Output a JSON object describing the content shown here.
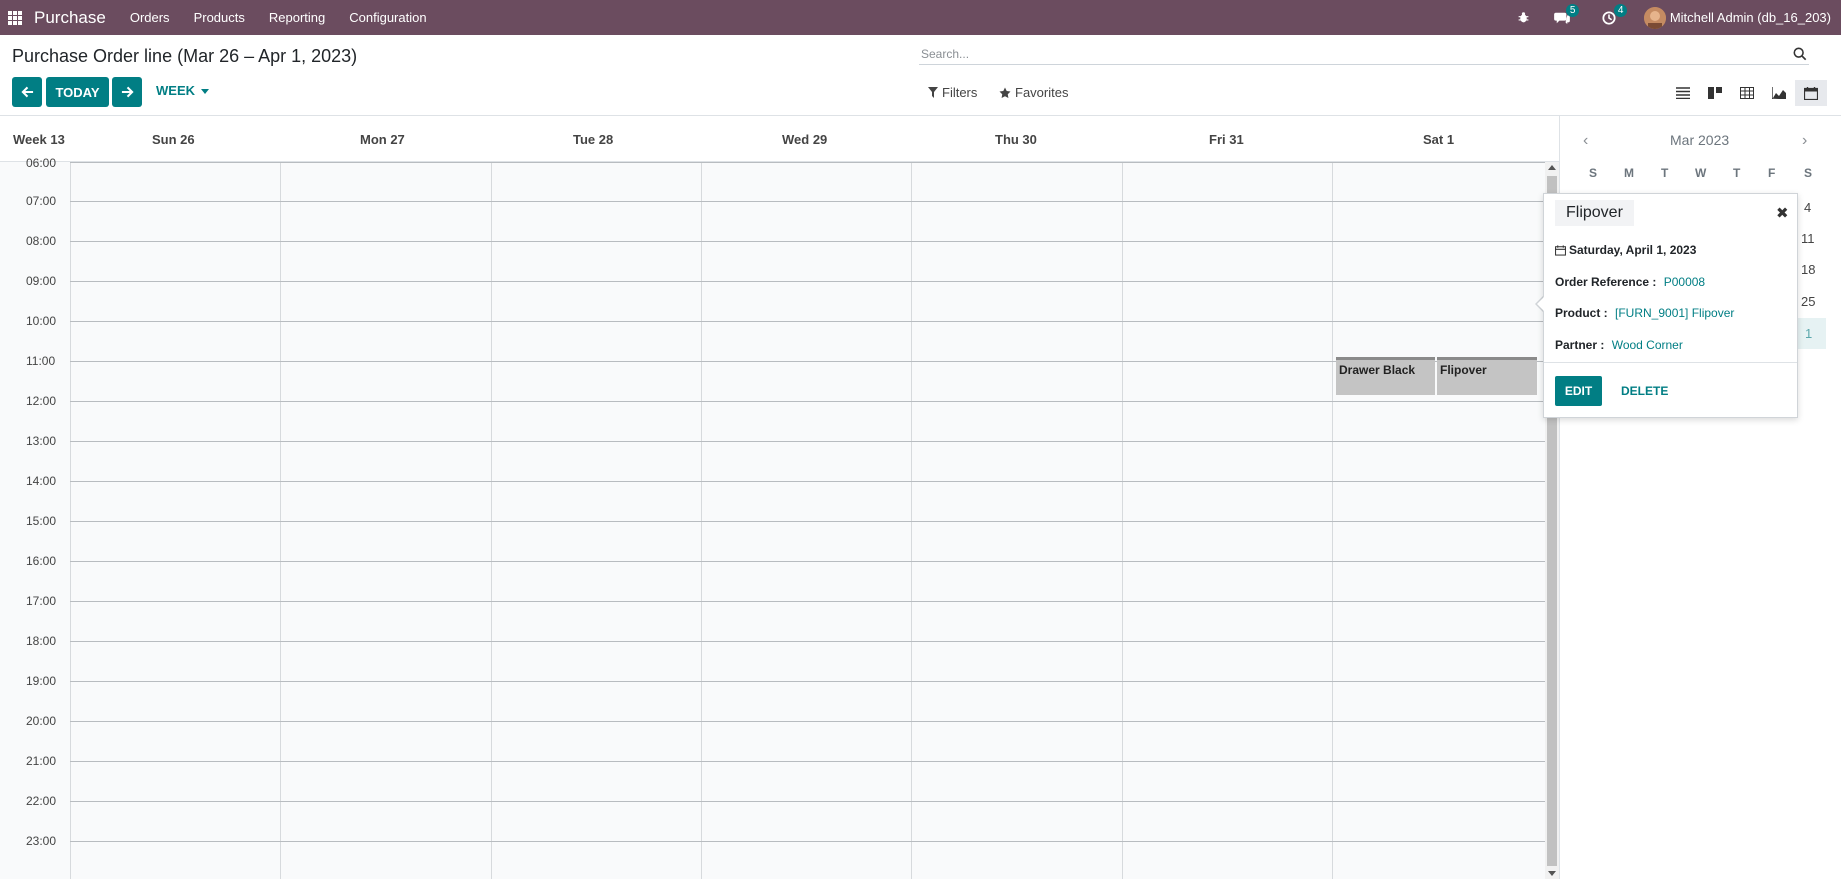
{
  "navbar": {
    "app_name": "Purchase",
    "menu": [
      "Orders",
      "Products",
      "Reporting",
      "Configuration"
    ],
    "messages_count": "5",
    "activities_count": "4",
    "user": "Mitchell Admin (db_16_203)"
  },
  "control": {
    "title": "Purchase Order line (Mar 26 – Apr 1, 2023)",
    "search_placeholder": "Search...",
    "today": "TODAY",
    "scale": "WEEK",
    "filters": "Filters",
    "favorites": "Favorites"
  },
  "calendar": {
    "week_label": "Week 13",
    "days": [
      "Sun 26",
      "Mon 27",
      "Tue 28",
      "Wed 29",
      "Thu 30",
      "Fri 31",
      "Sat 1"
    ],
    "hours": [
      "06:00",
      "07:00",
      "08:00",
      "09:00",
      "10:00",
      "11:00",
      "12:00",
      "13:00",
      "14:00",
      "15:00",
      "16:00",
      "17:00",
      "18:00",
      "19:00",
      "20:00",
      "21:00",
      "22:00",
      "23:00"
    ],
    "events": [
      {
        "title": "Drawer Black"
      },
      {
        "title": "Flipover"
      }
    ]
  },
  "mini_calendar": {
    "month": "Mar 2023",
    "weekdays": [
      "S",
      "M",
      "T",
      "W",
      "T",
      "F",
      "S"
    ],
    "visible_days": [
      "4",
      "11",
      "18",
      "25",
      "1"
    ]
  },
  "popover": {
    "title": "Flipover",
    "date": "Saturday, April 1, 2023",
    "order_ref_label": "Order Reference :",
    "order_ref": "P00008",
    "product_label": "Product :",
    "product": "[FURN_9001] Flipover",
    "partner_label": "Partner :",
    "partner": "Wood Corner",
    "edit": "EDIT",
    "delete": "DELETE"
  },
  "colors": {
    "navbar": "#6b4c5f",
    "primary": "#017e84",
    "event": "#c4c4c4"
  }
}
